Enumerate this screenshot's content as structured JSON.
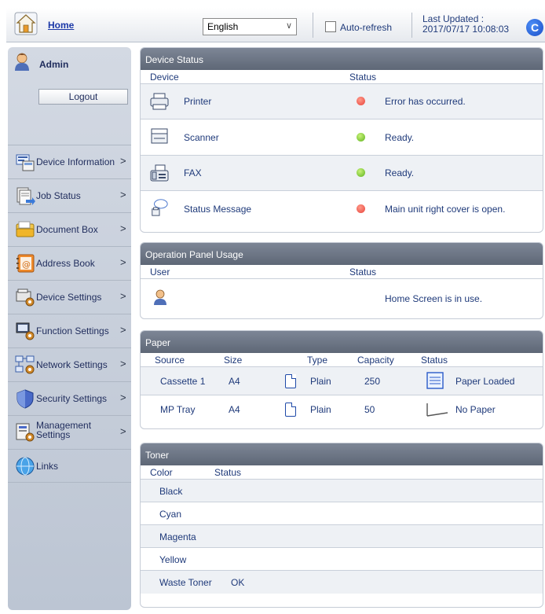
{
  "header": {
    "home_label": "Home",
    "language_value": "English",
    "auto_refresh_label": "Auto-refresh",
    "last_updated_label": "Last Updated :",
    "last_updated_value": "2017/07/17 10:08:03"
  },
  "sidebar": {
    "user_name": "Admin",
    "logout_label": "Logout",
    "items": [
      {
        "label": "Device Information",
        "icon": "device-information-icon"
      },
      {
        "label": "Job Status",
        "icon": "job-status-icon"
      },
      {
        "label": "Document Box",
        "icon": "document-box-icon"
      },
      {
        "label": "Address Book",
        "icon": "address-book-icon"
      },
      {
        "label": "Device Settings",
        "icon": "device-settings-icon"
      },
      {
        "label": "Function Settings",
        "icon": "function-settings-icon"
      },
      {
        "label": "Network Settings",
        "icon": "network-settings-icon"
      },
      {
        "label": "Security Settings",
        "icon": "security-settings-icon"
      },
      {
        "label": "Management Settings",
        "line1": "Management",
        "line2": "Settings",
        "icon": "management-settings-icon"
      },
      {
        "label": "Links",
        "icon": "links-icon"
      }
    ]
  },
  "device_status": {
    "title": "Device Status",
    "col_device": "Device",
    "col_status": "Status",
    "rows": [
      {
        "device": "Printer",
        "status": "Error has occurred.",
        "indicator": "red"
      },
      {
        "device": "Scanner",
        "status": "Ready.",
        "indicator": "green"
      },
      {
        "device": "FAX",
        "status": "Ready.",
        "indicator": "green"
      },
      {
        "device": "Status Message",
        "status": "Main unit right cover is open.",
        "indicator": "red"
      }
    ]
  },
  "operation_panel": {
    "title": "Operation Panel Usage",
    "col_user": "User",
    "col_status": "Status",
    "status": "Home Screen is in use."
  },
  "paper": {
    "title": "Paper",
    "col_source": "Source",
    "col_size": "Size",
    "col_type": "Type",
    "col_capacity": "Capacity",
    "col_status": "Status",
    "rows": [
      {
        "source": "Cassette 1",
        "size": "A4",
        "type": "Plain",
        "capacity": "250",
        "status": "Paper Loaded"
      },
      {
        "source": "MP Tray",
        "size": "A4",
        "type": "Plain",
        "capacity": "50",
        "status": "No Paper"
      }
    ]
  },
  "toner": {
    "title": "Toner",
    "col_color": "Color",
    "col_status": "Status",
    "rows": [
      {
        "color": "Black",
        "status": ""
      },
      {
        "color": "Cyan",
        "status": ""
      },
      {
        "color": "Magenta",
        "status": ""
      },
      {
        "color": "Yellow",
        "status": ""
      },
      {
        "color": "Waste Toner",
        "status": "OK"
      }
    ]
  },
  "colors": {
    "panel_header": "#6b7484",
    "text_blue": "#1f3a7a",
    "error_red": "#e8433a",
    "ready_green": "#5db31d"
  }
}
